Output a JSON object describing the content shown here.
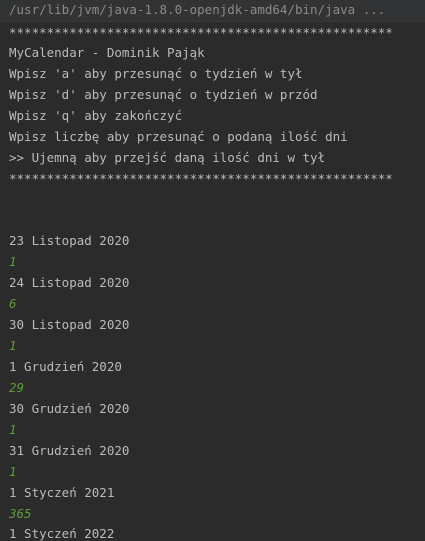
{
  "command": "/usr/lib/jvm/java-1.8.0-openjdk-amd64/bin/java ...",
  "header": {
    "stars": "***************************************************",
    "title": "MyCalendar - Dominik Pająk",
    "lines": [
      "Wpisz 'a' aby przesunąć o tydzień w tył",
      "Wpisz 'd' aby przesunąć o tydzień w przód",
      "Wpisz 'q' aby zakończyć",
      "Wpisz liczbę aby przesunąć o podaną ilość dni",
      ">> Ujemną aby przejść daną ilość dni w tył"
    ]
  },
  "output": [
    {
      "date": "23 Listopad 2020",
      "input": "1"
    },
    {
      "date": "24 Listopad 2020",
      "input": "6"
    },
    {
      "date": "30 Listopad 2020",
      "input": "1"
    },
    {
      "date": "1 Grudzień 2020",
      "input": "29"
    },
    {
      "date": "30 Grudzień 2020",
      "input": "1"
    },
    {
      "date": "31 Grudzień 2020",
      "input": "1"
    },
    {
      "date": "1 Styczeń 2021",
      "input": "365"
    },
    {
      "date": "1 Styczeń 2022",
      "input": ""
    }
  ],
  "colors": {
    "background": "#2b2b2b",
    "text": "#bbbbbb",
    "user_input": "#5e9c3a"
  }
}
